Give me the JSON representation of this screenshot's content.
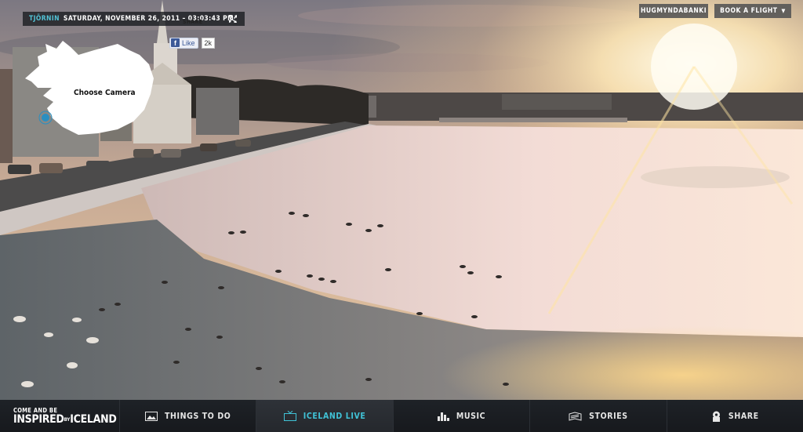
{
  "window": {
    "title": "Inspired by Iceland - Iceland Live"
  },
  "webcam": {
    "location": "TJÖRNIN",
    "datetime": "SATURDAY, NOVEMBER 26, 2011 – 03:03:43 PM",
    "share_label": "SHARE",
    "fb_like_label": "Like",
    "fb_like_count": "2k",
    "choose_camera_label": "Choose Camera"
  },
  "top_buttons": {
    "gallery": "HUGMYNDABANKI",
    "flight": "BOOK A FLIGHT"
  },
  "brand": {
    "line1": "COME AND BE",
    "inspired": "INSPIRED",
    "by": "BY",
    "iceland": "ICELAND"
  },
  "nav": [
    {
      "label": "THINGS TO DO",
      "icon": "image-icon",
      "active": false
    },
    {
      "label": "ICELAND LIVE",
      "icon": "tv-icon",
      "active": true
    },
    {
      "label": "MUSIC",
      "icon": "equalizer-icon",
      "active": false
    },
    {
      "label": "STORIES",
      "icon": "book-icon",
      "active": false
    },
    {
      "label": "SHARE",
      "icon": "share-icon",
      "active": false
    }
  ],
  "colors": {
    "accent": "#40c2d6",
    "navbar": "#1e2227"
  }
}
